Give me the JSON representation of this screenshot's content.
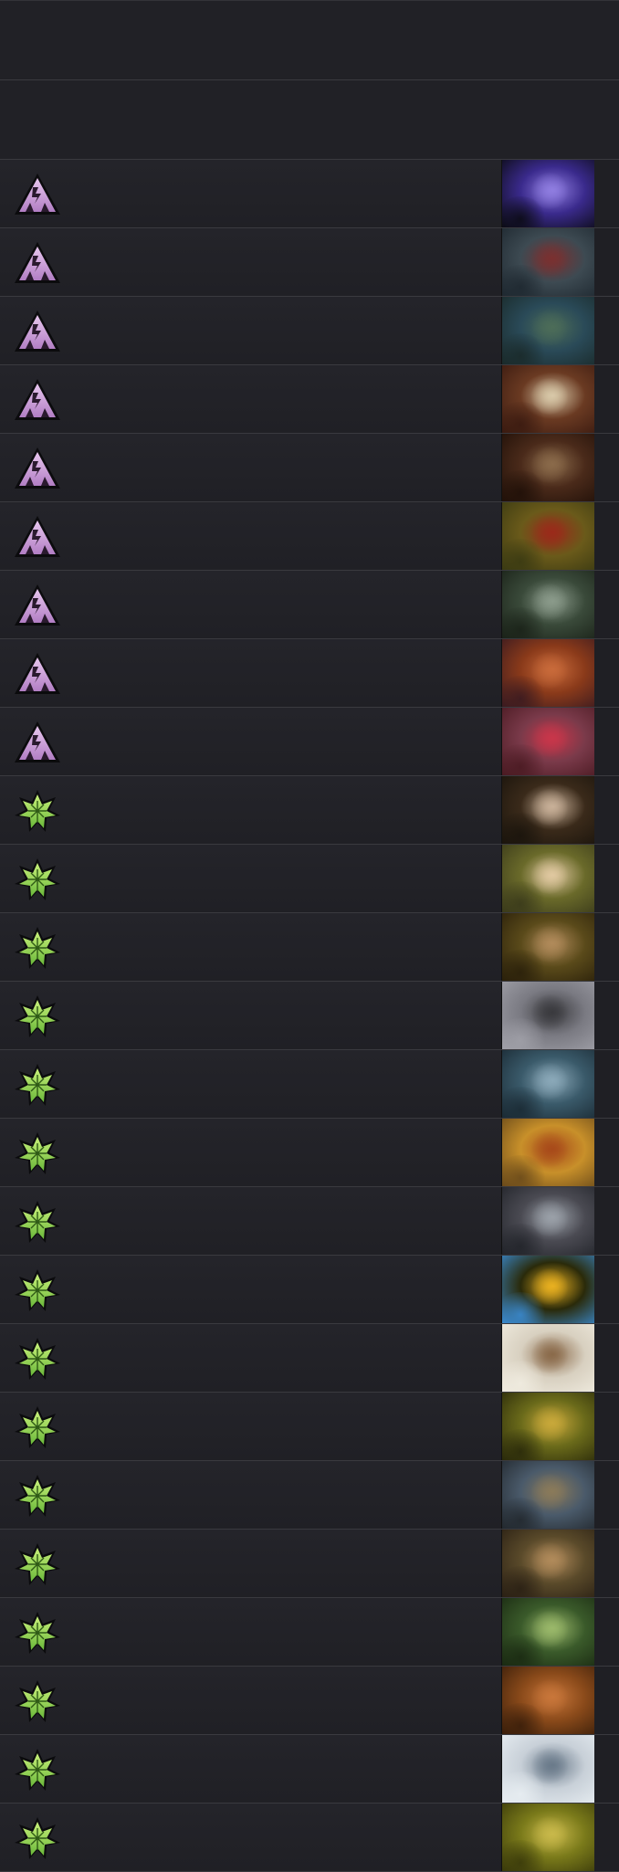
{
  "rows": [
    {
      "type": "chaos",
      "type_icon": "purple-triangle-icon",
      "art": "eclipse-art",
      "colors": [
        "#3a2a8c",
        "#8f7de0",
        "#0b0b14"
      ]
    },
    {
      "type": "chaos",
      "type_icon": "purple-triangle-icon",
      "art": "gator-creature-art",
      "colors": [
        "#3d4a52",
        "#7a3030",
        "#1e2830"
      ]
    },
    {
      "type": "chaos",
      "type_icon": "purple-triangle-icon",
      "art": "lizard-warrior-art",
      "colors": [
        "#2a4a58",
        "#4c6c58",
        "#1a2a2a"
      ]
    },
    {
      "type": "chaos",
      "type_icon": "purple-triangle-icon",
      "art": "skull-art",
      "colors": [
        "#6a3a22",
        "#d8c8a8",
        "#3a1a10"
      ]
    },
    {
      "type": "chaos",
      "type_icon": "purple-triangle-icon",
      "art": "ogre-throne-art",
      "colors": [
        "#4a2a1a",
        "#8a6a4a",
        "#201008"
      ]
    },
    {
      "type": "chaos",
      "type_icon": "purple-triangle-icon",
      "art": "armored-beast-art",
      "colors": [
        "#6a5a1a",
        "#9a2a1a",
        "#3a3a12"
      ]
    },
    {
      "type": "chaos",
      "type_icon": "purple-triangle-icon",
      "art": "shark-beast-art",
      "colors": [
        "#3a4a3a",
        "#8a9a8a",
        "#1a2218"
      ]
    },
    {
      "type": "chaos",
      "type_icon": "purple-triangle-icon",
      "art": "insect-art",
      "colors": [
        "#8a3a1a",
        "#c86a3a",
        "#3a1a20"
      ]
    },
    {
      "type": "chaos",
      "type_icon": "purple-triangle-icon",
      "art": "spiky-bug-art",
      "colors": [
        "#7a3a4a",
        "#c8364a",
        "#4a1a22"
      ]
    },
    {
      "type": "nature",
      "type_icon": "green-leaf-icon",
      "art": "rat-art",
      "colors": [
        "#3a2a1a",
        "#c8b098",
        "#1a140c"
      ]
    },
    {
      "type": "nature",
      "type_icon": "green-leaf-icon",
      "art": "bunny-art",
      "colors": [
        "#6a6a2a",
        "#e0c8a0",
        "#3a3a1a"
      ]
    },
    {
      "type": "nature",
      "type_icon": "green-leaf-icon",
      "art": "statue-art",
      "colors": [
        "#5a4a1a",
        "#b08a5a",
        "#2a200a"
      ]
    },
    {
      "type": "nature",
      "type_icon": "green-leaf-icon",
      "art": "mole-hill-art",
      "colors": [
        "#7a7a82",
        "#3a3a3e",
        "#a0a0a8"
      ]
    },
    {
      "type": "nature",
      "type_icon": "green-leaf-icon",
      "art": "snow-golem-art",
      "colors": [
        "#3a5a6a",
        "#8aa8b8",
        "#1a2a34"
      ]
    },
    {
      "type": "nature",
      "type_icon": "green-leaf-icon",
      "art": "fox-archer-art",
      "colors": [
        "#c8902a",
        "#a84a1a",
        "#6a4a1a"
      ]
    },
    {
      "type": "nature",
      "type_icon": "green-leaf-icon",
      "art": "wolves-art",
      "colors": [
        "#4a4a52",
        "#9aa0a8",
        "#22242a"
      ]
    },
    {
      "type": "nature",
      "type_icon": "green-leaf-icon",
      "art": "fairy-art",
      "colors": [
        "#2a2a0a",
        "#e8b020",
        "#3a8ad0"
      ]
    },
    {
      "type": "nature",
      "type_icon": "green-leaf-icon",
      "art": "owl-art",
      "colors": [
        "#d8d0c0",
        "#8a6a4a",
        "#f0ece0"
      ]
    },
    {
      "type": "nature",
      "type_icon": "green-leaf-icon",
      "art": "forest-spirit-art",
      "colors": [
        "#6a6a1a",
        "#c8a83a",
        "#2a2a0a"
      ]
    },
    {
      "type": "nature",
      "type_icon": "green-leaf-icon",
      "art": "beast-rider-art",
      "colors": [
        "#4a5a6a",
        "#8a7a5a",
        "#22282e"
      ]
    },
    {
      "type": "nature",
      "type_icon": "green-leaf-icon",
      "art": "bear-art",
      "colors": [
        "#5a4a2a",
        "#b08a5a",
        "#2a2014"
      ]
    },
    {
      "type": "nature",
      "type_icon": "green-leaf-icon",
      "art": "forest-silhouette-art",
      "colors": [
        "#3a5a2a",
        "#9ab86a",
        "#1a2a12"
      ]
    },
    {
      "type": "nature",
      "type_icon": "green-leaf-icon",
      "art": "grizzly-art",
      "colors": [
        "#8a4a1a",
        "#c8763a",
        "#3a1e0a"
      ]
    },
    {
      "type": "nature",
      "type_icon": "green-leaf-icon",
      "art": "white-wolf-art",
      "colors": [
        "#c8d0d8",
        "#6a7a8a",
        "#e8eef2"
      ]
    },
    {
      "type": "nature",
      "type_icon": "green-leaf-icon",
      "art": "ogre-hunter-art",
      "colors": [
        "#7a7a1a",
        "#c8b84a",
        "#3a3a0a"
      ]
    }
  ]
}
